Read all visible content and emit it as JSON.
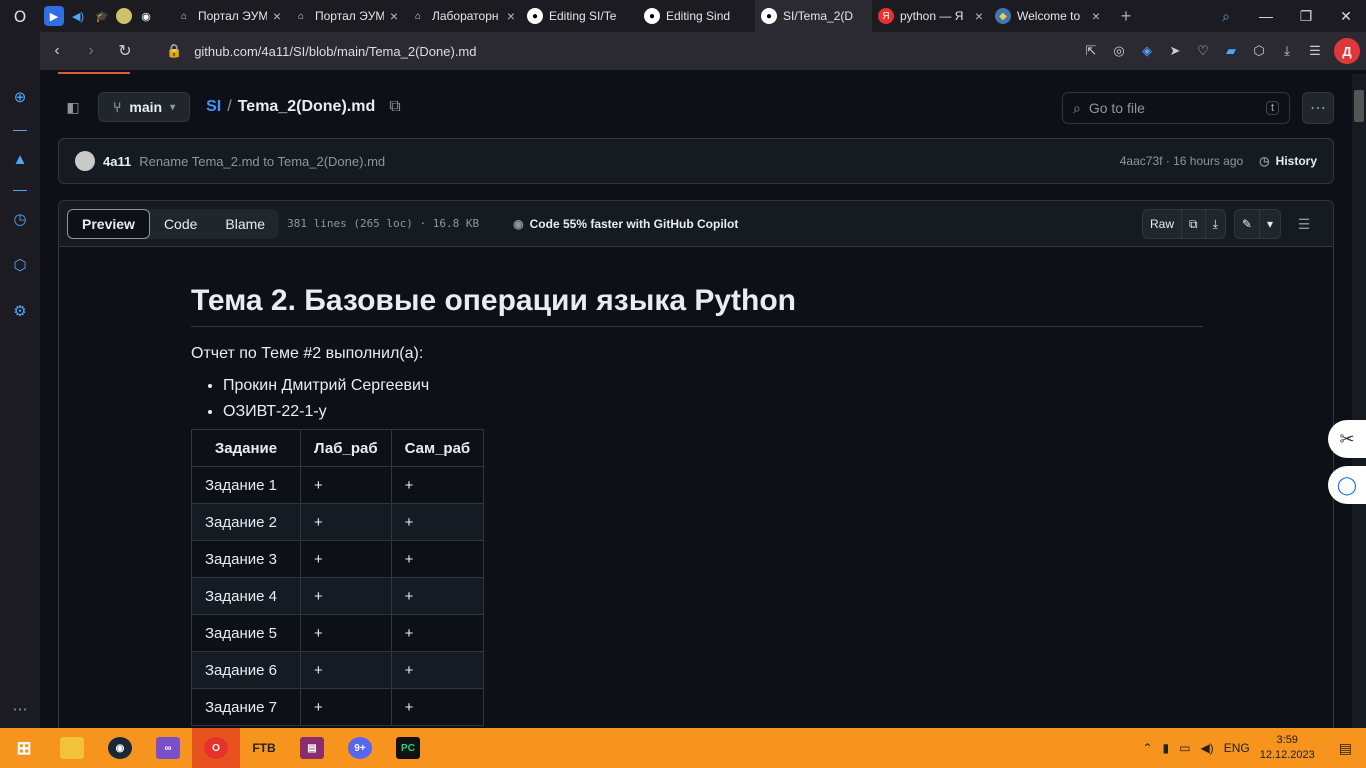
{
  "tabs": [
    {
      "title": "Портал ЭУМ",
      "favicon": "portal-icon"
    },
    {
      "title": "Портал ЭУМ",
      "favicon": "portal-icon"
    },
    {
      "title": "Лабораторн",
      "favicon": "portal-icon"
    },
    {
      "title": "Editing SI/Te",
      "favicon": "github-icon"
    },
    {
      "title": "Editing Sind",
      "favicon": "github-icon"
    },
    {
      "title": "SI/Tema_2(D",
      "favicon": "github-icon",
      "active": true
    },
    {
      "title": "python — Я",
      "favicon": "yandex-icon"
    },
    {
      "title": "Welcome to",
      "favicon": "python-icon"
    }
  ],
  "address": {
    "url": "github.com/4a11/SI/blob/main/Tema_2(Done).md"
  },
  "avatar_letter": "Д",
  "repo_nav": {
    "branch": "main",
    "repo": "SI",
    "separator": "/",
    "file": "Tema_2(Done).md",
    "goto_placeholder": "Go to file",
    "goto_kbd": "t"
  },
  "commit": {
    "author": "4a11",
    "message": "Rename Tema_2.md to Tema_2(Done).md",
    "meta": "4aac73f · 16 hours ago",
    "history_label": "History"
  },
  "file_header": {
    "tabs": [
      "Preview",
      "Code",
      "Blame"
    ],
    "info": "381 lines (265 loc) · 16.8 KB",
    "copilot": "Code 55% faster with GitHub Copilot",
    "raw": "Raw"
  },
  "doc": {
    "title": "Тема 2. Базовые операции языка Python",
    "intro": "Отчет по Теме #2 выполнил(а):",
    "bullets": [
      "Прокин Дмитрий Сергеевич",
      "ОЗИВТ-22-1-у"
    ],
    "table": {
      "headers": [
        "Задание",
        "Лаб_раб",
        "Сам_раб"
      ],
      "rows": [
        [
          "Задание 1",
          "+",
          "+"
        ],
        [
          "Задание 2",
          "+",
          "+"
        ],
        [
          "Задание 3",
          "+",
          "+"
        ],
        [
          "Задание 4",
          "+",
          "+"
        ],
        [
          "Задание 5",
          "+",
          "+"
        ],
        [
          "Задание 6",
          "+",
          "+"
        ],
        [
          "Задание 7",
          "+",
          "+"
        ]
      ]
    }
  },
  "taskbar": {
    "lang": "ENG",
    "time": "3:59",
    "date": "12.12.2023",
    "ftb": "FTB",
    "pc": "PC",
    "badge": "9+"
  },
  "colors": {
    "accent": "#4493f8",
    "taskbar": "#f7941d"
  }
}
